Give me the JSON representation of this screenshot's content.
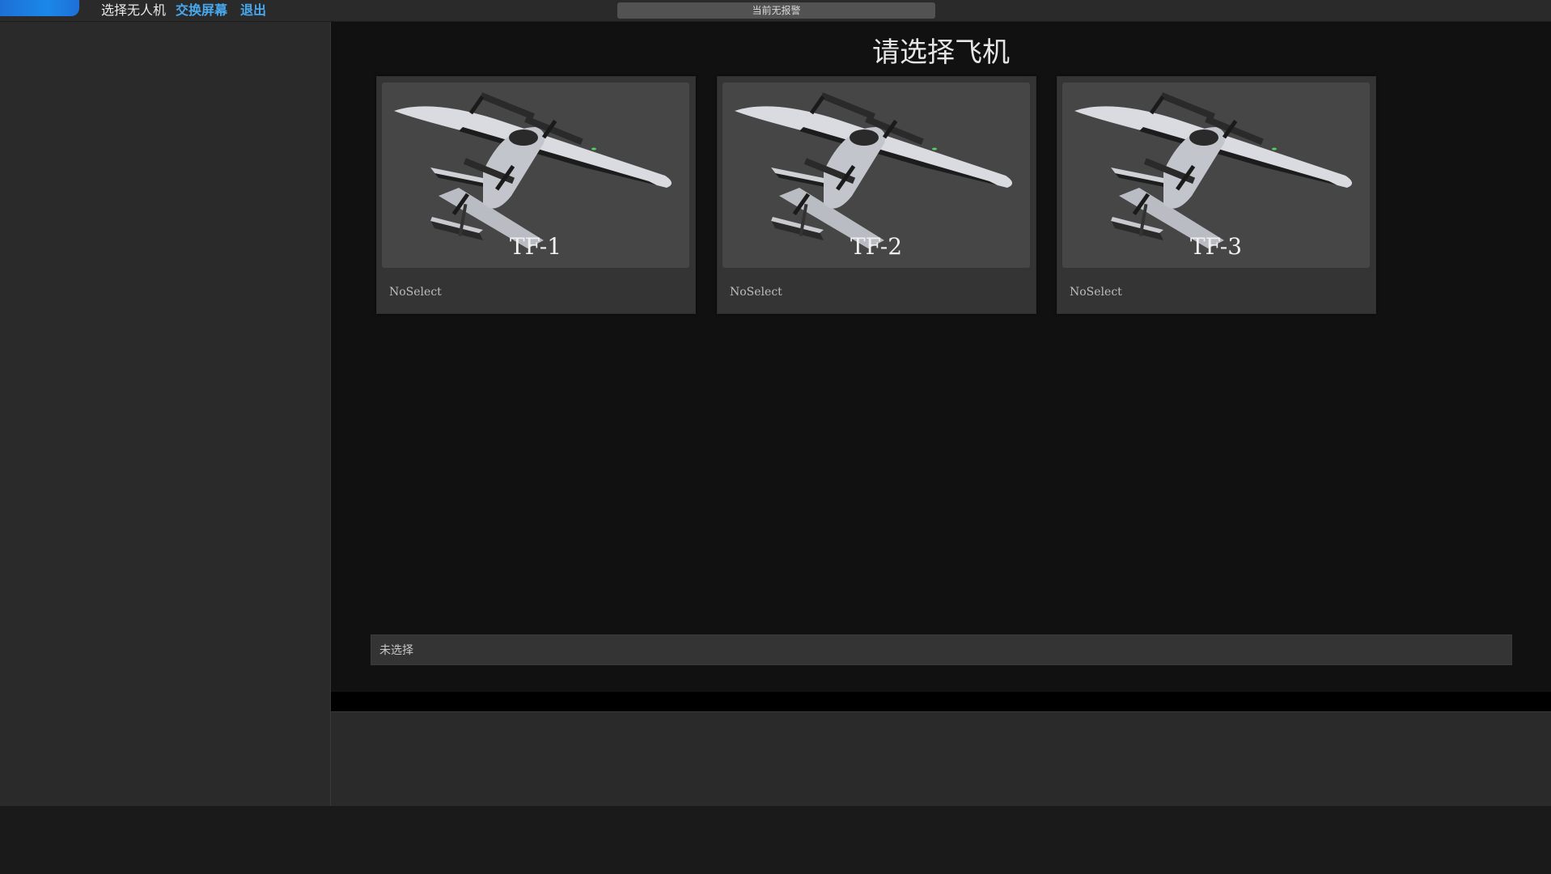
{
  "topbar": {
    "menu_select_drone": "选择无人机",
    "menu_swap_screen": "交换屏幕",
    "menu_exit": "退出",
    "alarm_text": "当前无报警"
  },
  "main": {
    "title": "请选择飞机",
    "cards": [
      {
        "name": "TF-1",
        "status": "NoSelect"
      },
      {
        "name": "TF-2",
        "status": "NoSelect"
      },
      {
        "name": "TF-3",
        "status": "NoSelect"
      }
    ],
    "selection_text": "未选择"
  },
  "colors": {
    "accent": "#47a8ee",
    "logo": "#1a88e8",
    "background": "#111111",
    "panel": "#2a2a2a",
    "card": "#343434"
  },
  "icons": {
    "card_image": "vtol-drone-image"
  }
}
